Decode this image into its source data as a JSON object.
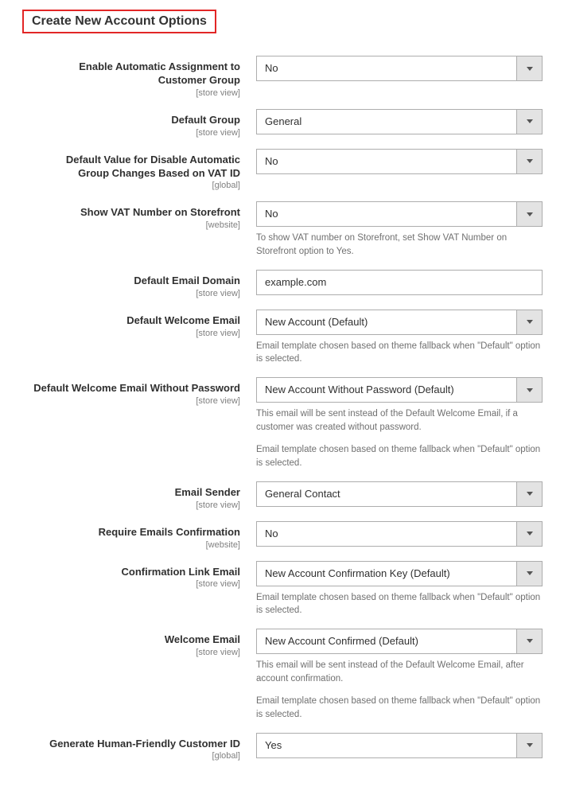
{
  "section_title": "Create New Account Options",
  "fields": {
    "auto_assign": {
      "label": "Enable Automatic Assignment to Customer Group",
      "scope": "[store view]",
      "value": "No"
    },
    "default_group": {
      "label": "Default Group",
      "scope": "[store view]",
      "value": "General"
    },
    "disable_auto_group": {
      "label": "Default Value for Disable Automatic Group Changes Based on VAT ID",
      "scope": "[global]",
      "value": "No"
    },
    "show_vat": {
      "label": "Show VAT Number on Storefront",
      "scope": "[website]",
      "value": "No",
      "help": "To show VAT number on Storefront, set Show VAT Number on Storefront option to Yes."
    },
    "email_domain": {
      "label": "Default Email Domain",
      "scope": "[store view]",
      "value": "example.com"
    },
    "welcome_email": {
      "label": "Default Welcome Email",
      "scope": "[store view]",
      "value": "New Account (Default)",
      "help": "Email template chosen based on theme fallback when \"Default\" option is selected."
    },
    "welcome_email_no_pw": {
      "label": "Default Welcome Email Without Password",
      "scope": "[store view]",
      "value": "New Account Without Password (Default)",
      "help1": "This email will be sent instead of the Default Welcome Email, if a customer was created without password.",
      "help2": "Email template chosen based on theme fallback when \"Default\" option is selected."
    },
    "email_sender": {
      "label": "Email Sender",
      "scope": "[store view]",
      "value": "General Contact"
    },
    "require_confirm": {
      "label": "Require Emails Confirmation",
      "scope": "[website]",
      "value": "No"
    },
    "confirm_link": {
      "label": "Confirmation Link Email",
      "scope": "[store view]",
      "value": "New Account Confirmation Key (Default)",
      "help": "Email template chosen based on theme fallback when \"Default\" option is selected."
    },
    "welcome_confirmed": {
      "label": "Welcome Email",
      "scope": "[store view]",
      "value": "New Account Confirmed (Default)",
      "help1": "This email will be sent instead of the Default Welcome Email, after account confirmation.",
      "help2": "Email template chosen based on theme fallback when \"Default\" option is selected."
    },
    "human_friendly_id": {
      "label": "Generate Human-Friendly Customer ID",
      "scope": "[global]",
      "value": "Yes"
    }
  }
}
